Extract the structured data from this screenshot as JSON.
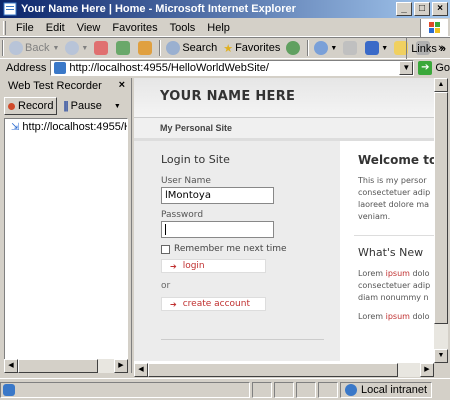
{
  "window": {
    "title": "Your Name Here | Home - Microsoft Internet Explorer",
    "controls": {
      "minimize": "_",
      "maximize": "□",
      "close": "×"
    }
  },
  "menu": [
    "File",
    "Edit",
    "View",
    "Favorites",
    "Tools",
    "Help"
  ],
  "toolbar": {
    "back": "Back",
    "search": "Search",
    "favorites": "Favorites",
    "links": "Links",
    "chevron": "»"
  },
  "address": {
    "label": "Address",
    "url": "http://localhost:4955/HelloWorldWebSite/",
    "go": "Go"
  },
  "recorder": {
    "title": "Web Test Recorder",
    "close": "×",
    "record": "Record",
    "pause": "Pause",
    "tree_item": "http://localhost:4955/HelloWorldWebSite/"
  },
  "site": {
    "name": "YOUR NAME HERE",
    "subtitle": "My Personal Site"
  },
  "login": {
    "title": "Login to Site",
    "user_label": "User Name",
    "user_value": "lMontoya",
    "password_label": "Password",
    "remember": "Remember me next time",
    "login_button": "login",
    "or": "or",
    "create_button": "create account"
  },
  "welcome": {
    "title": "Welcome to",
    "lines": [
      "This is my persor",
      "consectetuer adip",
      "laoreet dolore ma",
      "veniam."
    ],
    "news_title": "What's New",
    "news_lines": [
      {
        "pre": "Lorem ",
        "hl": "ipsum",
        "post": " dolo"
      },
      {
        "pre": "consectetuer adip",
        "hl": "",
        "post": ""
      },
      {
        "pre": "diam nonummy n",
        "hl": "",
        "post": ""
      },
      {
        "pre": "Lorem ",
        "hl": "ipsum",
        "post": " dolo"
      }
    ]
  },
  "status": {
    "zone": "Local intranet"
  },
  "colors": {
    "titlebar_start": "#0a246a",
    "titlebar_end": "#a6caf0",
    "chrome": "#d4d0c8",
    "link_red": "#c03030"
  }
}
